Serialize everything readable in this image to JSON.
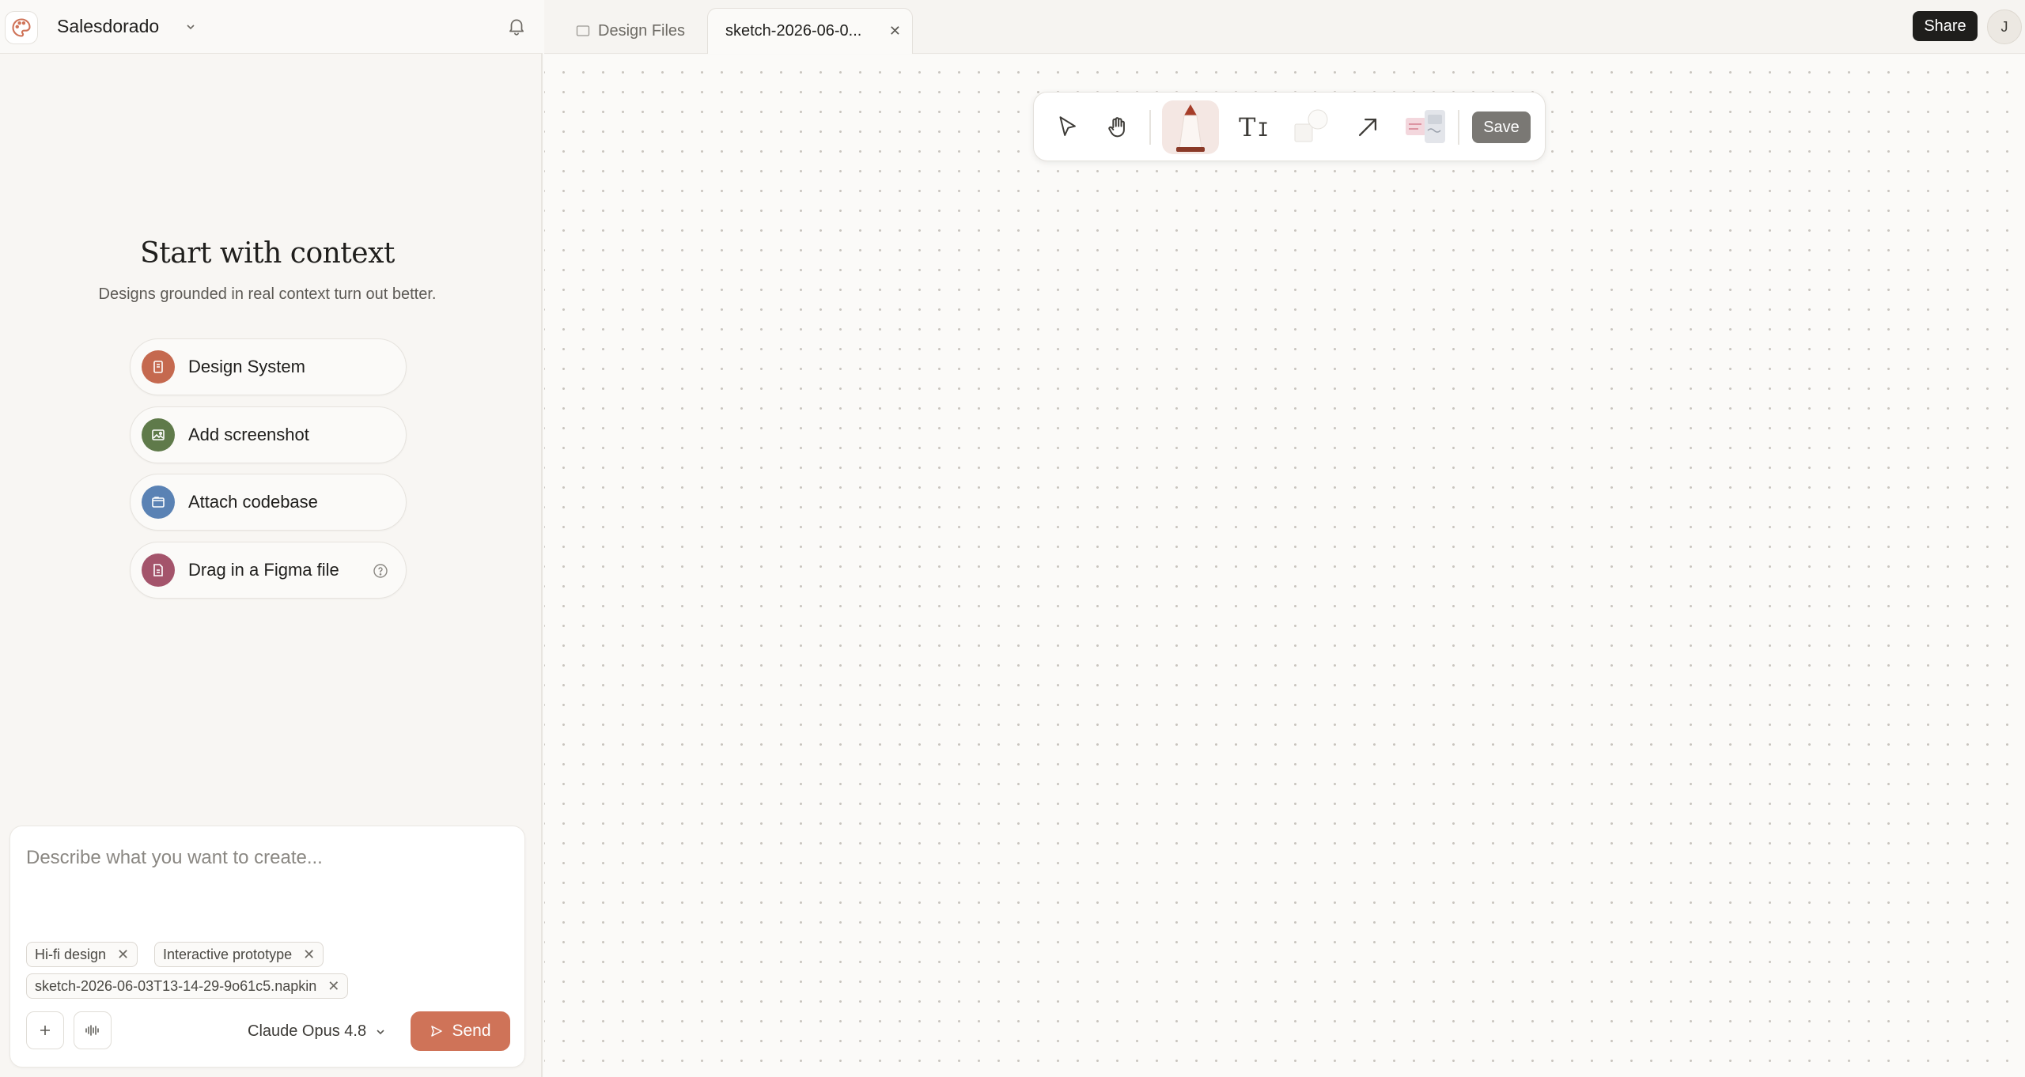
{
  "header": {
    "project_name": "Salesdorado"
  },
  "context": {
    "title": "Start with context",
    "subtitle": "Designs grounded in real context turn out better.",
    "options": [
      {
        "label": "Design System",
        "icon": "book-icon",
        "color": "#c5694f"
      },
      {
        "label": "Add screenshot",
        "icon": "image-icon",
        "color": "#5f7a4a"
      },
      {
        "label": "Attach codebase",
        "icon": "folder-icon",
        "color": "#5a82b4"
      },
      {
        "label": "Drag in a Figma file",
        "icon": "file-icon",
        "color": "#a4546b"
      }
    ]
  },
  "composer": {
    "placeholder": "Describe what you want to create...",
    "chips": [
      "Hi-fi design",
      "Interactive prototype",
      "sketch-2026-06-03T13-14-29-9o61c5.napkin"
    ],
    "model": "Claude Opus 4.8",
    "send_label": "Send"
  },
  "tabs": {
    "design_files": "Design Files",
    "active_tab": "sketch-2026-06-0..."
  },
  "topbar": {
    "share_label": "Share",
    "avatar_initial": "J"
  },
  "toolbar": {
    "tools": [
      "select-tool",
      "hand-tool",
      "pencil-tool",
      "text-tool",
      "shape-tool",
      "arrow-tool",
      "sticky-note-tool"
    ],
    "active_tool": "pencil-tool",
    "save_label": "Save"
  },
  "colors": {
    "accent": "#cf7358",
    "share_bg": "#1f1e1c",
    "save_bg": "#7a7874"
  }
}
